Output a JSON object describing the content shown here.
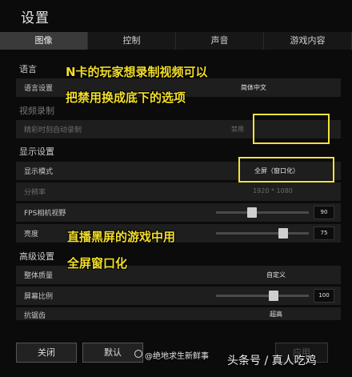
{
  "window": {
    "title": "设置"
  },
  "tabs": [
    {
      "label": "图像",
      "active": true
    },
    {
      "label": "控制"
    },
    {
      "label": "声音"
    },
    {
      "label": "游戏内容"
    }
  ],
  "sections": {
    "language": "语言",
    "video_record": "视频录制",
    "display": "显示设置",
    "advanced": "高级设置"
  },
  "rows": {
    "language": {
      "label": "语言设置",
      "value": "简体中文"
    },
    "highlight": {
      "label": "精彩时刻自动录制",
      "value": "禁用"
    },
    "display_mode": {
      "label": "显示模式",
      "value": "全屏（窗口化）"
    },
    "resolution": {
      "label": "分辨率",
      "value": "1920 * 1080"
    },
    "fov": {
      "label": "FPS相机视野",
      "value": "90",
      "level": 0.39
    },
    "brightness": {
      "label": "亮度",
      "value": "75",
      "level": 0.72
    },
    "quality": {
      "label": "整体质量",
      "value": "自定义"
    },
    "screen_scale": {
      "label": "屏幕比例",
      "value": "100",
      "level": 0.62
    },
    "antialias": {
      "label": "抗锯齿",
      "value": "超高"
    }
  },
  "annotations": {
    "line1": "N卡的玩家想录制视频可以",
    "line2": "把禁用换成底下的选项",
    "line3": "直播黑屏的游戏中用",
    "line4": "全屏窗口化"
  },
  "buttons": {
    "close": "关闭",
    "default": "默认",
    "apply": "应用"
  },
  "watermark": {
    "account": "@绝地求生新鲜事",
    "brand": "头条号 / 真人吃鸡"
  },
  "colors": {
    "highlight": "#f3e33a",
    "annotation": "#f2de2a",
    "active_tab": "#3a3a3a"
  }
}
